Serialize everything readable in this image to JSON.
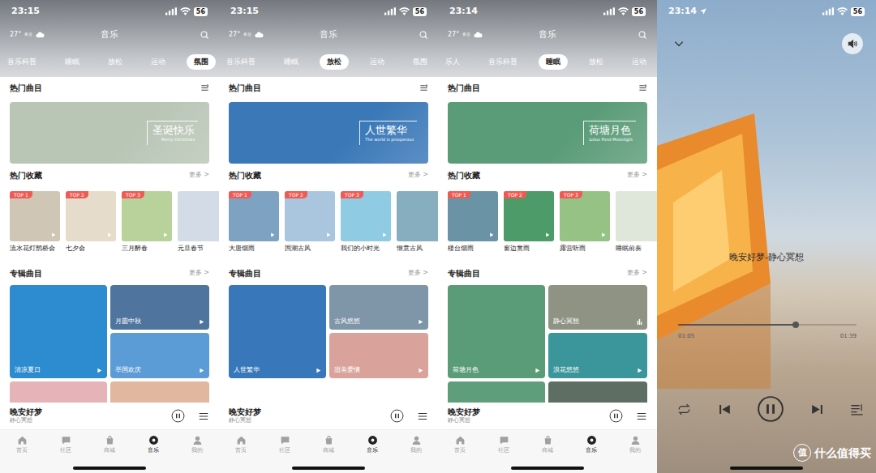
{
  "screens": [
    {
      "kind": "browse",
      "status": {
        "time": "23:15",
        "battery": "56"
      },
      "weather": {
        "temp": "27°",
        "desc": "多云"
      },
      "title": "音乐",
      "tabs": [
        {
          "label": "音乐科普",
          "selected": false
        },
        {
          "label": "睡眠",
          "selected": false
        },
        {
          "label": "放松",
          "selected": false
        },
        {
          "label": "运动",
          "selected": false
        },
        {
          "label": "氛围",
          "selected": true
        }
      ],
      "hot": {
        "title": "热门曲目",
        "banner": {
          "title": "圣诞快乐",
          "subtitle": "Merry Christmas",
          "color": "#b9c6b6"
        }
      },
      "collections": {
        "title": "热门收藏",
        "more": "更多 >",
        "items": [
          {
            "rank": "TOP 1",
            "label": "流水花灯鹊桥会",
            "color": "#cfc6b6"
          },
          {
            "rank": "TOP 2",
            "label": "七夕会",
            "color": "#e6dccb"
          },
          {
            "rank": "TOP 3",
            "label": "三月醉春",
            "color": "#b9d29c"
          },
          {
            "label": "元旦春节",
            "color": "#d3dbe6"
          }
        ]
      },
      "albums": {
        "title": "专辑曲目",
        "more": "更多 >",
        "items": [
          {
            "label": "清凉夏日",
            "color": "#2d8ccf",
            "playing": false
          },
          {
            "label": "月圆中秋",
            "color": "#4f759e",
            "playing": false
          },
          {
            "label": "举国欢庆",
            "color": "#5b9bd6",
            "playing": false
          }
        ],
        "peek": [
          {
            "color": "#e6b3b8"
          },
          {
            "color": "#e2b79f"
          }
        ]
      },
      "mini_player": {
        "title": "晚安好梦",
        "subtitle": "静心冥想",
        "playing": true
      },
      "nav": [
        {
          "label": "首页",
          "selected": false
        },
        {
          "label": "社区",
          "selected": false
        },
        {
          "label": "商城",
          "selected": false
        },
        {
          "label": "音乐",
          "selected": true
        },
        {
          "label": "我的",
          "selected": false
        }
      ]
    },
    {
      "kind": "browse",
      "status": {
        "time": "23:15",
        "battery": "56"
      },
      "weather": {
        "temp": "27°",
        "desc": "多云"
      },
      "title": "音乐",
      "tabs": [
        {
          "label": "音乐科普",
          "selected": false
        },
        {
          "label": "睡眠",
          "selected": false
        },
        {
          "label": "放松",
          "selected": true
        },
        {
          "label": "运动",
          "selected": false
        },
        {
          "label": "氛围",
          "selected": false
        }
      ],
      "hot": {
        "title": "热门曲目",
        "banner": {
          "title": "人世繁华",
          "subtitle": "The world is prosperous",
          "color": "#3a78b8"
        }
      },
      "collections": {
        "title": "热门收藏",
        "more": "更多 >",
        "items": [
          {
            "rank": "TOP 1",
            "label": "大唐烟雨",
            "color": "#7ea3c2"
          },
          {
            "rank": "TOP 2",
            "label": "国潮古风",
            "color": "#a9c6de"
          },
          {
            "rank": "TOP 3",
            "label": "我们的小时光",
            "color": "#8fcbe3"
          },
          {
            "label": "惬意古风",
            "color": "#86aebf"
          }
        ]
      },
      "albums": {
        "title": "专辑曲目",
        "more": "更多 >",
        "items": [
          {
            "label": "人世繁华",
            "color": "#3877b9",
            "playing": false
          },
          {
            "label": "古风悠悠",
            "color": "#7f95a8",
            "playing": false
          },
          {
            "label": "甜美爱情",
            "color": "#d9a29a",
            "playing": false
          }
        ],
        "peek": []
      },
      "mini_player": {
        "title": "晚安好梦",
        "subtitle": "静心冥想",
        "playing": true
      },
      "nav": [
        {
          "label": "首页",
          "selected": false
        },
        {
          "label": "社区",
          "selected": false
        },
        {
          "label": "商城",
          "selected": false
        },
        {
          "label": "音乐",
          "selected": true
        },
        {
          "label": "我的",
          "selected": false
        }
      ]
    },
    {
      "kind": "browse",
      "status": {
        "time": "23:14",
        "battery": "56"
      },
      "weather": {
        "temp": "27°",
        "desc": "多云"
      },
      "title": "音乐",
      "tabs": [
        {
          "label": "乐人",
          "selected": false
        },
        {
          "label": "音乐科普",
          "selected": false
        },
        {
          "label": "睡眠",
          "selected": true
        },
        {
          "label": "放松",
          "selected": false
        },
        {
          "label": "运动",
          "selected": false
        }
      ],
      "hot": {
        "title": "热门曲目",
        "banner": {
          "title": "荷塘月色",
          "subtitle": "Lotus Pond Moonlight",
          "color": "#5b9c78"
        }
      },
      "collections": {
        "title": "热门收藏",
        "more": "更多 >",
        "items": [
          {
            "rank": "TOP 1",
            "label": "楼台烟雨",
            "color": "#6a93a6"
          },
          {
            "rank": "TOP 2",
            "label": "窗边赏雨",
            "color": "#4d9b68"
          },
          {
            "rank": "TOP 3",
            "label": "露营听雨",
            "color": "#97c285"
          },
          {
            "label": "睡眠前奏",
            "color": "#dfe6da"
          }
        ]
      },
      "albums": {
        "title": "专辑曲目",
        "more": "更多 >",
        "items": [
          {
            "label": "荷塘月色",
            "color": "#5b9c78",
            "playing": false
          },
          {
            "label": "静心冥想",
            "color": "#8f9384",
            "playing": true
          },
          {
            "label": "浪花悠悠",
            "color": "#3a969a",
            "playing": false
          }
        ],
        "peek": [
          {
            "color": "#5f9e7a"
          },
          {
            "color": "#5f6e62"
          }
        ]
      },
      "mini_player": {
        "title": "晚安好梦",
        "subtitle": "静心冥想",
        "playing": true
      },
      "nav": [
        {
          "label": "首页",
          "selected": false
        },
        {
          "label": "社区",
          "selected": false
        },
        {
          "label": "商城",
          "selected": false
        },
        {
          "label": "音乐",
          "selected": true
        },
        {
          "label": "我的",
          "selected": false
        }
      ]
    },
    {
      "kind": "player",
      "status": {
        "time": "23:14",
        "battery": "56",
        "location": true
      },
      "title": "晚安好梦-静心冥想",
      "progress": {
        "level": 0.66,
        "elapsed": "01:05",
        "total": "01:39"
      },
      "playing": true,
      "watermark": {
        "logo": "值",
        "text": "什么值得买"
      }
    }
  ]
}
